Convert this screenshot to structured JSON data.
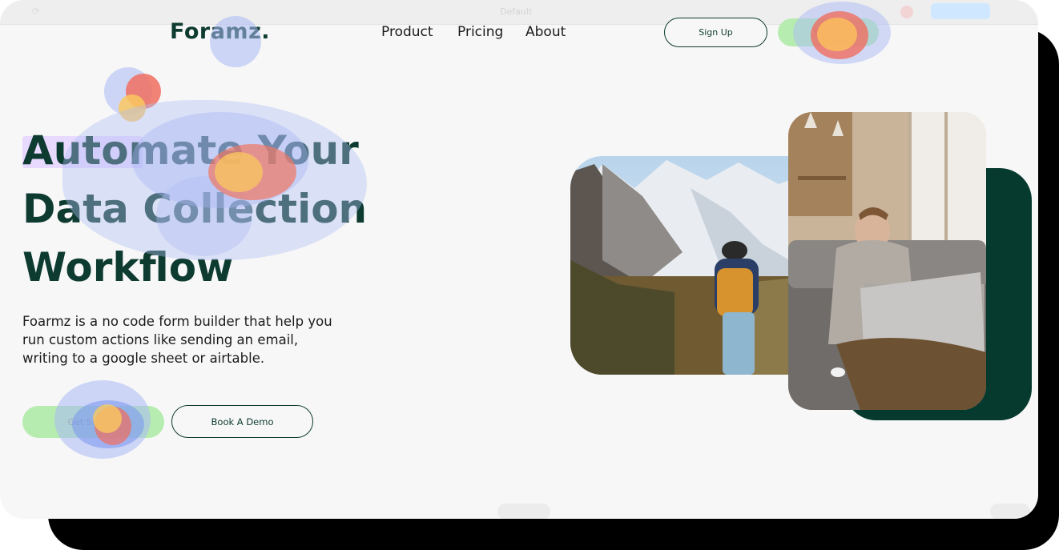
{
  "topbar": {
    "title": "Default"
  },
  "brand": {
    "logo": "Foramz."
  },
  "nav": {
    "items": [
      "Product",
      "Pricing",
      "About"
    ]
  },
  "auth": {
    "sign_up": "Sign Up",
    "sign_in": "Sign In"
  },
  "hero": {
    "title_lines": [
      "Automate Your",
      "Data Collection",
      "Workflow"
    ],
    "description": "Foarmz is a no code form builder that help you run custom actions like sending an email, writing to a google sheet or airtable.",
    "cta_primary": "Get Started",
    "cta_secondary": "Book A Demo"
  },
  "colors": {
    "brand_dark_green": "#0d3b30",
    "accent_green": "#b7ecb0",
    "card_green": "#063a2e",
    "page_bg": "#f7f7f7"
  }
}
